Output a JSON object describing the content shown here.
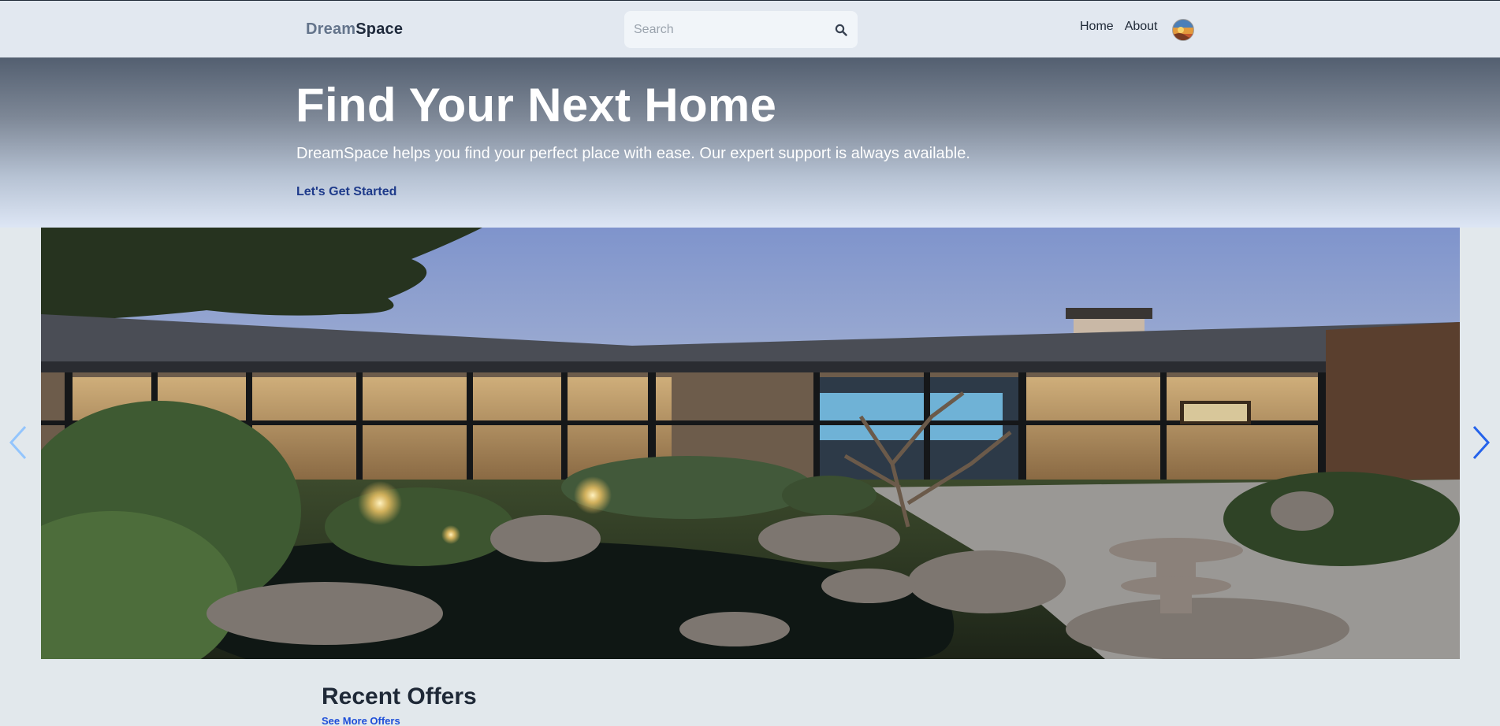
{
  "navbar": {
    "brand_part1": "Dream",
    "brand_part2": "Space",
    "search_placeholder": "Search",
    "links": [
      "Home",
      "About"
    ],
    "icons": {
      "search": "search-icon",
      "avatar": "user-avatar"
    }
  },
  "hero": {
    "title": "Find Your Next Home",
    "subtitle": "DreamSpace helps you find your perfect place with ease. Our expert support is always available.",
    "cta": "Let's Get Started"
  },
  "carousel": {
    "image_subject": "modern-house-with-japanese-garden",
    "controls": {
      "prev": "chevron-left-icon",
      "next": "chevron-right-icon"
    }
  },
  "offers": {
    "title": "Recent Offers",
    "link": "See More Offers"
  },
  "colors": {
    "nav_bg": "#e2e8f0",
    "page_bg": "#e2e8ec",
    "cta_link": "#1e3a8a",
    "offers_link": "#1d4ed8",
    "arrow_prev": "#93c5fd",
    "arrow_next": "#2563eb"
  }
}
